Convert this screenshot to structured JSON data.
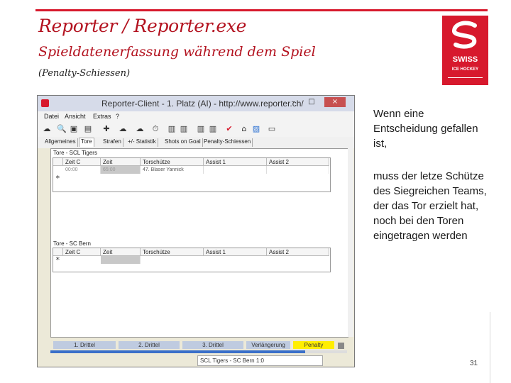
{
  "slide": {
    "title": "Reporter / Reporter.exe",
    "subtitle": "Spieldatenerfassung während dem Spiel",
    "note": "(Penalty-Schiessen)",
    "page_number": "31",
    "text_block_1": [
      "Wenn eine",
      "Entscheidung gefallen",
      "ist,"
    ],
    "text_block_2": [
      "muss der letze Schütze",
      "des Siegreichen Teams,",
      "der das Tor erzielt hat,",
      "noch bei den Toren",
      "eingetragen werden"
    ],
    "logo": {
      "line1": "SWISS",
      "line2": "ICE HOCKEY"
    },
    "accent_color": "#d7192d"
  },
  "window": {
    "title": "Reporter-Client - 1. Platz (AI) - http://www.reporter.ch/",
    "controls": {
      "minimize": "–",
      "maximize": "□",
      "close": "×"
    },
    "menu": [
      "Datei",
      "Ansicht",
      "Extras",
      "?"
    ],
    "toolbar_icons": [
      "cloud-download-icon",
      "search-icon",
      "save-icon",
      "clipboard-icon",
      "player-icon",
      "cloud-up-icon",
      "cloud-icon",
      "timer-icon",
      "lineup-icon",
      "lineup-icon-2",
      "lineup-icon-3",
      "lineup-icon-4",
      "check-icon",
      "home-icon",
      "user-icon",
      "tv-icon"
    ],
    "toolbar_glyphs": [
      "☁",
      "🔍",
      "▣",
      "▤",
      "✚",
      "☁",
      "☁",
      "⏱",
      "▥",
      "▥",
      "▥",
      "▥",
      "✔",
      "⌂",
      "▨",
      "▭"
    ],
    "tabs": [
      "Allgemeines",
      "Tore",
      "Strafen",
      "+/- Statistik",
      "Shots on Goal",
      "Penalty-Schiessen"
    ],
    "active_tab": "Tore",
    "group1": {
      "title": "Tore - SCL Tigers",
      "columns": [
        "Zeit C",
        "Zeit",
        "Torschütze",
        "Assist 1",
        "Assist 2"
      ],
      "rows": [
        [
          "00:00",
          "65:00",
          "47. Blaser Yannick",
          "",
          ""
        ]
      ],
      "new_row_marker": "*"
    },
    "group2": {
      "title": "Tore - SC Bern",
      "columns": [
        "Zeit C",
        "Zeit",
        "Torschütze",
        "Assist 1",
        "Assist 2"
      ],
      "rows": [],
      "new_row_marker": "*"
    },
    "periods": [
      "1. Drittel",
      "2. Drittel",
      "3. Drittel",
      "Verlängerung",
      "Penalty"
    ],
    "active_period": "Penalty",
    "active_period_color": "#ffee00",
    "progress_fraction": 0.86,
    "status": "SCL Tigers - SC Bern 1:0"
  }
}
